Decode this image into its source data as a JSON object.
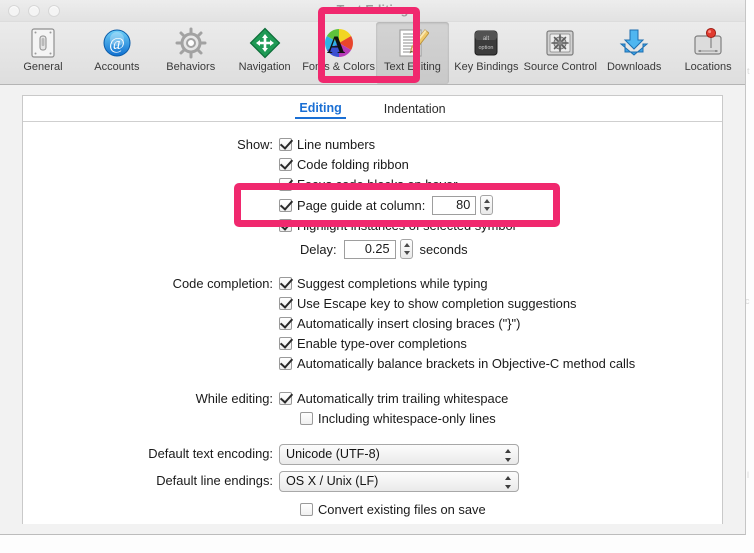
{
  "window": {
    "title": "Text Editing",
    "traffic_lights": [
      "close-button",
      "minimize-button",
      "zoom-button"
    ]
  },
  "toolbar": {
    "items": [
      {
        "label": "General",
        "icon": "general-icon",
        "selected": false
      },
      {
        "label": "Accounts",
        "icon": "accounts-icon",
        "selected": false
      },
      {
        "label": "Behaviors",
        "icon": "behaviors-icon",
        "selected": false
      },
      {
        "label": "Navigation",
        "icon": "navigation-icon",
        "selected": false
      },
      {
        "label": "Fonts & Colors",
        "icon": "fonts-colors-icon",
        "selected": false
      },
      {
        "label": "Text Editing",
        "icon": "text-editing-icon",
        "selected": true
      },
      {
        "label": "Key Bindings",
        "icon": "key-bindings-icon",
        "selected": false
      },
      {
        "label": "Source Control",
        "icon": "source-control-icon",
        "selected": false
      },
      {
        "label": "Downloads",
        "icon": "downloads-icon",
        "selected": false
      },
      {
        "label": "Locations",
        "icon": "locations-icon",
        "selected": false
      }
    ]
  },
  "tabs": [
    {
      "label": "Editing",
      "active": true
    },
    {
      "label": "Indentation",
      "active": false
    }
  ],
  "form": {
    "show": {
      "label": "Show:",
      "line_numbers": {
        "label": "Line numbers",
        "checked": true
      },
      "code_folding_ribbon": {
        "label": "Code folding ribbon",
        "checked": true
      },
      "focus_code_blocks": {
        "label": "Focus code blocks on hover",
        "checked": true
      },
      "page_guide": {
        "label": "Page guide at column:",
        "checked": true,
        "value": "80"
      },
      "highlight_instances": {
        "label": "Highlight instances of selected symbol",
        "checked": true
      },
      "delay": {
        "label": "Delay:",
        "value": "0.25",
        "units": "seconds"
      }
    },
    "code_completion": {
      "label": "Code completion:",
      "items": [
        {
          "label": "Suggest completions while typing",
          "checked": true
        },
        {
          "label": "Use Escape key to show completion suggestions",
          "checked": true
        },
        {
          "label": "Automatically insert closing braces (\"}\")",
          "checked": true
        },
        {
          "label": "Enable type-over completions",
          "checked": true
        },
        {
          "label": "Automatically balance brackets in Objective-C method calls",
          "checked": true
        }
      ]
    },
    "while_editing": {
      "label": "While editing:",
      "items": [
        {
          "label": "Automatically trim trailing whitespace",
          "checked": true
        },
        {
          "label": "Including whitespace-only lines",
          "checked": false
        }
      ]
    },
    "default_text_encoding": {
      "label": "Default text encoding:",
      "value": "Unicode (UTF-8)"
    },
    "default_line_endings": {
      "label": "Default line endings:",
      "value": "OS X / Unix (LF)"
    },
    "convert_existing": {
      "label": "Convert existing files on save",
      "checked": false
    }
  },
  "annotations": {
    "color": "#f0286e",
    "boxes": [
      {
        "name": "toolbar-text-editing-highlight"
      },
      {
        "name": "page-guide-row-highlight"
      }
    ]
  }
}
